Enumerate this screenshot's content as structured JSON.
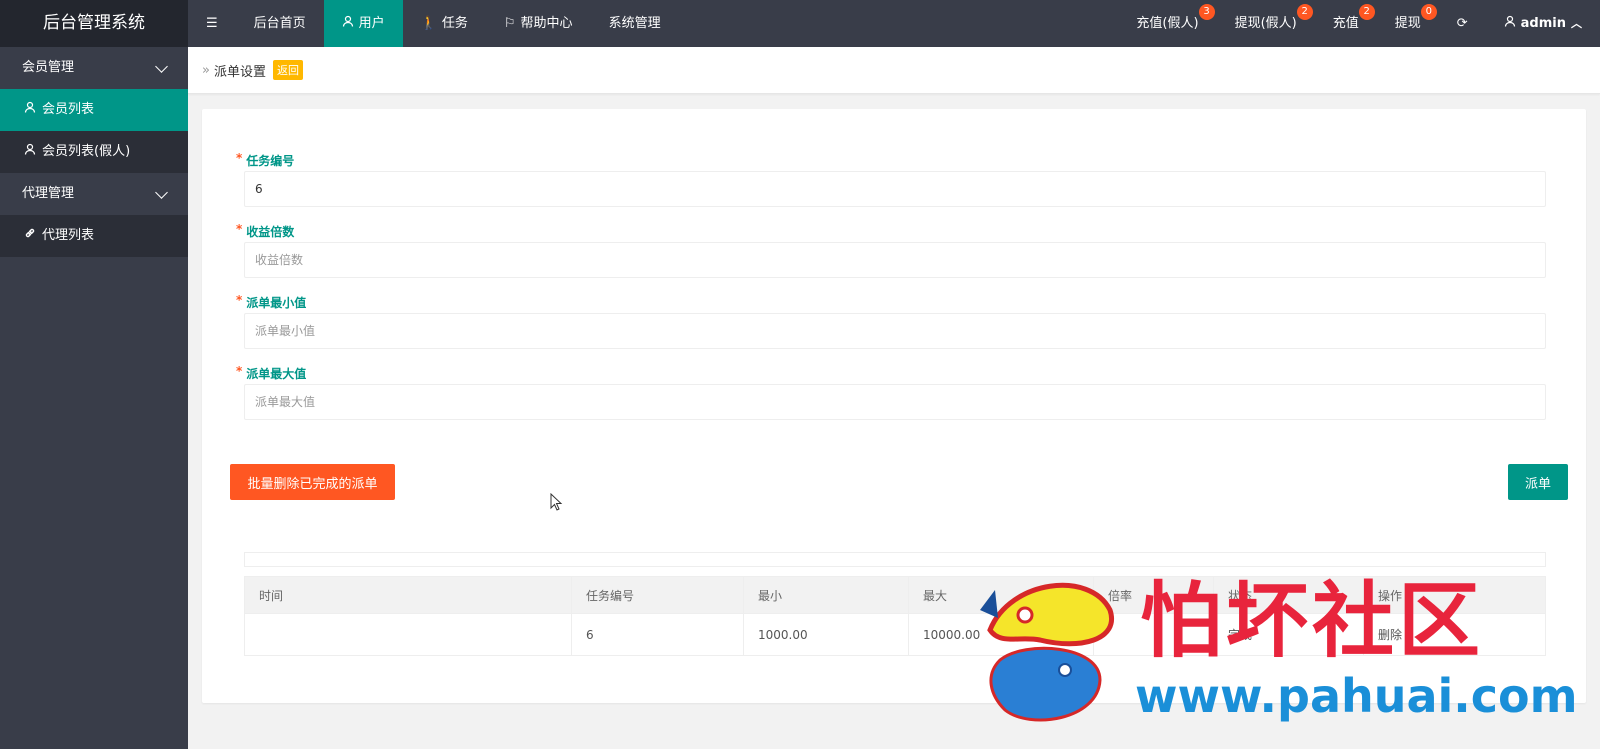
{
  "app": {
    "title": "后台管理系统"
  },
  "topnav": {
    "menu_toggle_icon": "menu-lines-icon",
    "items": [
      {
        "label": "后台首页",
        "icon": "",
        "active": false
      },
      {
        "label": "用户",
        "icon": "user-icon",
        "active": true
      },
      {
        "label": "任务",
        "icon": "walk-icon",
        "active": false
      },
      {
        "label": "帮助中心",
        "icon": "flag-icon",
        "active": false
      },
      {
        "label": "系统管理",
        "icon": "",
        "active": false
      }
    ],
    "right": [
      {
        "label": "充值(假人)",
        "badge": "3"
      },
      {
        "label": "提现(假人)",
        "badge": "2"
      },
      {
        "label": "充值",
        "badge": "2"
      },
      {
        "label": "提现",
        "badge": "0"
      }
    ],
    "refresh_icon": "refresh-icon",
    "user": {
      "name": "admin"
    }
  },
  "sidebar": {
    "groups": [
      {
        "label": "会员管理",
        "items": [
          {
            "label": "会员列表",
            "icon": "user-icon",
            "active": true
          },
          {
            "label": "会员列表(假人)",
            "icon": "user-icon",
            "active": false
          }
        ]
      },
      {
        "label": "代理管理",
        "items": [
          {
            "label": "代理列表",
            "icon": "link-icon",
            "active": false
          }
        ]
      }
    ]
  },
  "breadcrumb": {
    "separator": "»",
    "title": "派单设置",
    "back_label": "返回"
  },
  "form": {
    "fields": [
      {
        "label": "任务编号",
        "value": "6",
        "placeholder": ""
      },
      {
        "label": "收益倍数",
        "value": "",
        "placeholder": "收益倍数"
      },
      {
        "label": "派单最小值",
        "value": "",
        "placeholder": "派单最小值"
      },
      {
        "label": "派单最大值",
        "value": "",
        "placeholder": "派单最大值"
      }
    ],
    "required_mark": "*",
    "batch_delete_label": "批量删除已完成的派单",
    "dispatch_label": "派单"
  },
  "table": {
    "headers": [
      "时间",
      "任务编号",
      "最小",
      "最大",
      "倍率",
      "状态",
      "操作"
    ],
    "rows": [
      {
        "time": "",
        "task_id": "6",
        "min": "1000.00",
        "max": "10000.00",
        "rate": "",
        "status": "完成",
        "action": "删除"
      }
    ]
  },
  "watermark": {
    "title": "怕坏社区",
    "url": "www.pahuai.com"
  },
  "colors": {
    "header_bg": "#393d49",
    "accent": "#009688",
    "danger": "#ff5722",
    "warning": "#ffb800"
  }
}
